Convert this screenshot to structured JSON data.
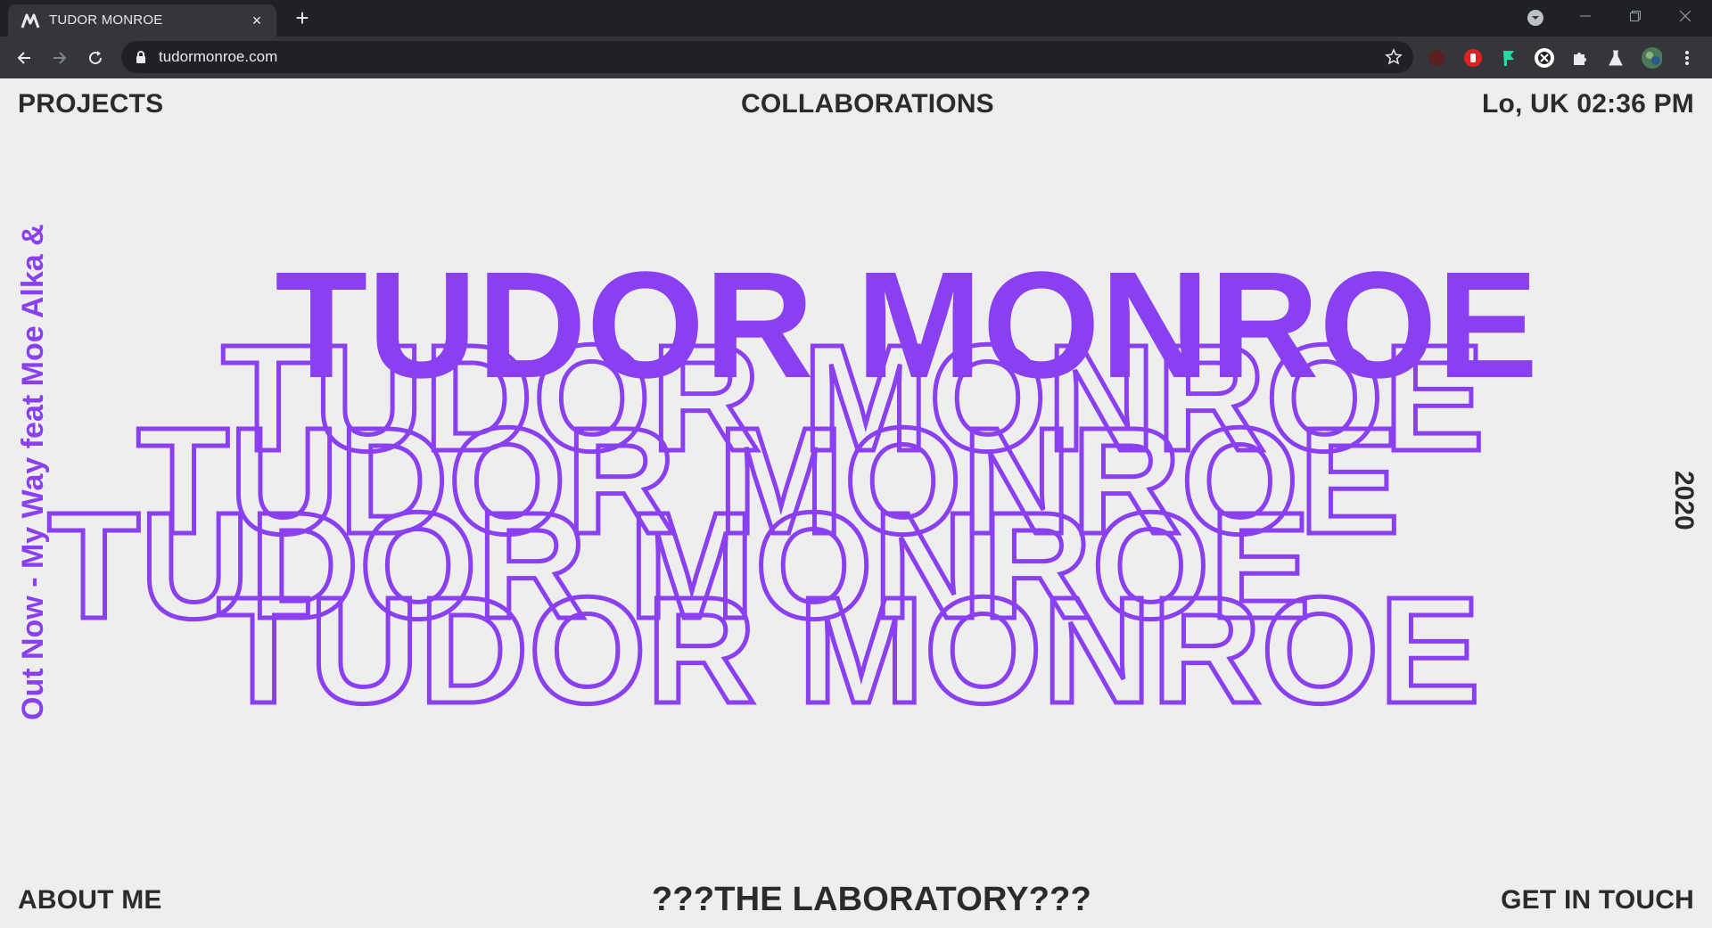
{
  "browser": {
    "tab_title": "TUDOR MONROE",
    "tab_close": "×",
    "new_tab": "+",
    "url": "tudormonroe.com"
  },
  "nav": {
    "projects": "PROJECTS",
    "collaborations": "COLLABORATIONS",
    "clock": "Lo, UK 02:36 PM",
    "about": "ABOUT ME",
    "laboratory": "???THE LABORATORY???",
    "contact": "GET IN TOUCH"
  },
  "release_banner": "Out Now - My Way feat Moe Alka &",
  "year": "2020",
  "hero": {
    "title": "TUDOR MONROE",
    "outlines": [
      "TUDOR MONROE",
      "TUDOR MONROE",
      "TUDOR MONROE",
      "TUDOR MONROE"
    ]
  },
  "colors": {
    "accent": "#8a3ff0",
    "text": "#2b2b2b",
    "background": "#eeeeee"
  }
}
